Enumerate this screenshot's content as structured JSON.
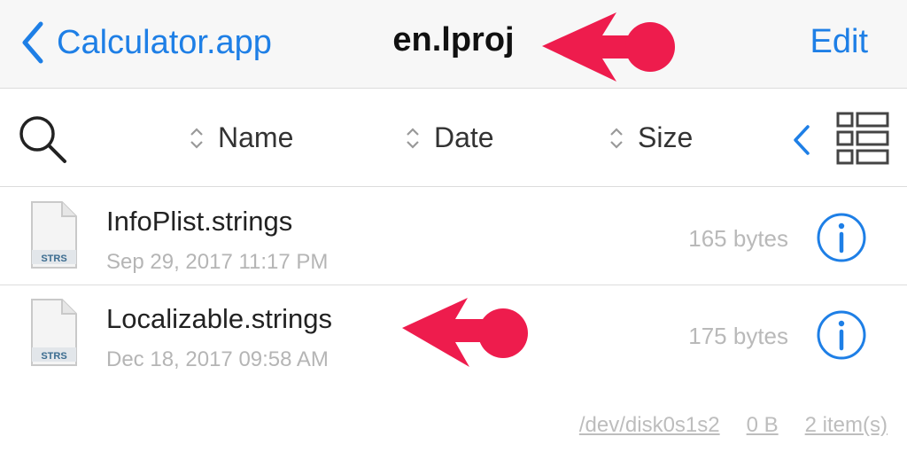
{
  "navbar": {
    "back_label": "Calculator.app",
    "title": "en.lproj",
    "edit_label": "Edit"
  },
  "toolbar": {
    "sort_options": [
      "Name",
      "Date",
      "Size"
    ],
    "icons": [
      "search-icon",
      "sort-arrows-icon",
      "chevron-left-icon",
      "list-view-icon"
    ]
  },
  "files": [
    {
      "name": "InfoPlist.strings",
      "date": "Sep 29, 2017 11:17 PM",
      "size": "165 bytes",
      "type_badge": "STRS"
    },
    {
      "name": "Localizable.strings",
      "date": "Dec 18, 2017 09:58 AM",
      "size": "175 bytes",
      "type_badge": "STRS"
    }
  ],
  "footer": {
    "path": "/dev/disk0s1s2",
    "space": "0 B",
    "count": "2 item(s)"
  },
  "colors": {
    "accent": "#1e7fe6",
    "annotation": "#ee1c4d",
    "secondary_text": "#b5b5b5"
  }
}
